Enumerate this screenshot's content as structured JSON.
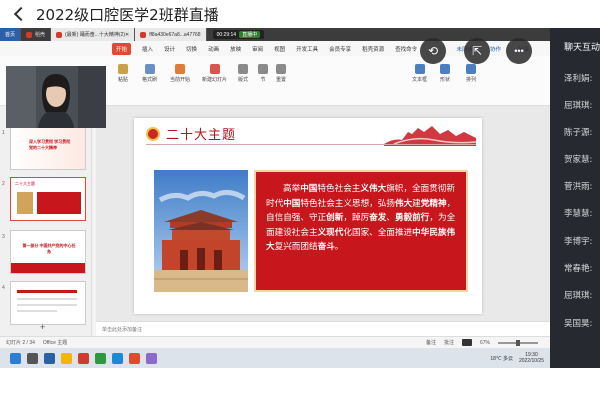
{
  "window": {
    "title": "2022级口腔医学2班群直播"
  },
  "controls": [
    {
      "name": "screen-rotate-icon",
      "glyph": "⟲"
    },
    {
      "name": "share-icon",
      "glyph": "⇱"
    },
    {
      "name": "more-icon",
      "glyph": "•••"
    }
  ],
  "tabs": [
    {
      "label": "稻壳"
    },
    {
      "label": "(最新) 踊而奋...十大精神(2)"
    },
    {
      "label": "ff8a430e67a8...a47768"
    }
  ],
  "recording": {
    "time": "00:29:14",
    "status": "直播中"
  },
  "menu": {
    "start": "开始",
    "items": [
      "插入",
      "设计",
      "切换",
      "动画",
      "放映",
      "审阅",
      "视图",
      "开发工具",
      "会员专享",
      "稻壳资源"
    ],
    "find_label": "查找命令",
    "right": [
      "未同步",
      "协作",
      "分享"
    ]
  },
  "ribbon": {
    "paste": "粘贴",
    "format_painter": "格式刷",
    "from_current": "当前开始",
    "new_slide": "新建幻灯片",
    "layout": "版式",
    "section": "节",
    "reset": "重置",
    "textbox": "文本框",
    "shape": "形状",
    "arrange": "排列"
  },
  "slide": {
    "heading": "二十大主题",
    "body_parts": [
      {
        "text": "高举",
        "bold": false
      },
      {
        "text": "中国",
        "bold": true
      },
      {
        "text": "特色社会主",
        "bold": false
      },
      {
        "text": "义伟大",
        "bold": true
      },
      {
        "text": "旗帜，全面贯彻新时代",
        "bold": false
      },
      {
        "text": "中国",
        "bold": true
      },
      {
        "text": "特色社会主义思想，弘扬",
        "bold": false
      },
      {
        "text": "伟大",
        "bold": true
      },
      {
        "text": "建",
        "bold": false
      },
      {
        "text": "党精神",
        "bold": true
      },
      {
        "text": "，自信自强、守正",
        "bold": false
      },
      {
        "text": "创新",
        "bold": true
      },
      {
        "text": "，踔厉",
        "bold": false
      },
      {
        "text": "奋发",
        "bold": true
      },
      {
        "text": "、",
        "bold": false
      },
      {
        "text": "勇毅前行",
        "bold": true
      },
      {
        "text": "，为全面建设社会主",
        "bold": false
      },
      {
        "text": "义现代",
        "bold": true
      },
      {
        "text": "化国家、全面推进",
        "bold": false
      },
      {
        "text": "中华民族伟大",
        "bold": true
      },
      {
        "text": "复兴而团结",
        "bold": false
      },
      {
        "text": "奋斗",
        "bold": true
      },
      {
        "text": "。",
        "bold": false
      }
    ]
  },
  "thumbs": [
    {
      "num": "1",
      "text": "深入学习贯彻 学习贯彻党的二十大精神"
    },
    {
      "num": "2",
      "text": "二十大主题"
    },
    {
      "num": "3",
      "text": "第一部分 中国共产党的中心任务"
    },
    {
      "num": "4",
      "text": ""
    }
  ],
  "notes": {
    "placeholder": "单击此处添加备注"
  },
  "status": {
    "slide_index": "幻灯片 2 / 34",
    "theme": "Office 主题",
    "notes_toggle": "备注",
    "comments": "批注",
    "zoom": "67%"
  },
  "tray": {
    "weather": "18℃ 多云",
    "time": "19:30",
    "date": "2022/10/25"
  },
  "chat": {
    "title": "聊天互动",
    "names": [
      "泽利娟:",
      "屈琪琪:",
      "陈子源:",
      "贺家慧:",
      "菅洪雨:",
      "李慧慧:",
      "李博宇:",
      "常春艳:",
      "屈琪琪:",
      "吴国昊:"
    ]
  },
  "colors": {
    "accent_red": "#c8161d",
    "wps_orange": "#e04b2f",
    "chat_bg": "#262a30"
  }
}
